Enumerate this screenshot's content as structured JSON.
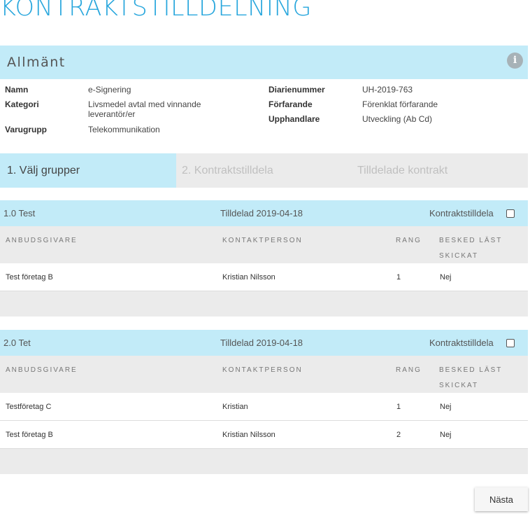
{
  "page": {
    "title": "KONTRAKTSTILLDELNING"
  },
  "general": {
    "title": "Allmänt",
    "fields_left": [
      {
        "label": "Namn",
        "value": "e-Signering"
      },
      {
        "label": "Kategori",
        "value": "Livsmedel avtal med vinnande leverantör/er"
      },
      {
        "label": "Varugrupp",
        "value": "Telekommunikation"
      }
    ],
    "fields_right": [
      {
        "label": "Diarienummer",
        "value": "UH-2019-763"
      },
      {
        "label": "Förfarande",
        "value": "Förenklat förfarande"
      },
      {
        "label": "Upphandlare",
        "value": "Utveckling (Ab Cd)"
      }
    ]
  },
  "tabs": [
    {
      "label": "1. Välj grupper",
      "active": true
    },
    {
      "label": "2. Kontraktstilldela",
      "active": false
    },
    {
      "label": "Tilldelade kontrakt",
      "active": false
    }
  ],
  "columns": {
    "supplier": "ANBUDSGIVARE",
    "contact": "KONTAKTPERSON",
    "rank": "RANG",
    "read": "BESKED LÄST SKICKAT"
  },
  "groups": [
    {
      "name": "1.0 Test",
      "date": "Tilldelad 2019-04-18",
      "award_label": "Kontraktstilldela",
      "rows": [
        {
          "supplier": "Test företag B",
          "contact": "Kristian Nilsson",
          "rank": "1",
          "read": "Nej"
        }
      ]
    },
    {
      "name": "2.0 Tet",
      "date": "Tilldelad 2019-04-18",
      "award_label": "Kontraktstilldela",
      "rows": [
        {
          "supplier": "Testföretag C",
          "contact": "Kristian",
          "rank": "1",
          "read": "Nej"
        },
        {
          "supplier": "Test företag B",
          "contact": "Kristian Nilsson",
          "rank": "2",
          "read": "Nej"
        }
      ]
    }
  ],
  "actions": {
    "next_label": "Nästa"
  },
  "icons": {
    "info": "info-icon"
  },
  "colors": {
    "accent": "#29a7dd",
    "header_bg": "#c2ebf8",
    "row_alt": "#ebebeb"
  }
}
